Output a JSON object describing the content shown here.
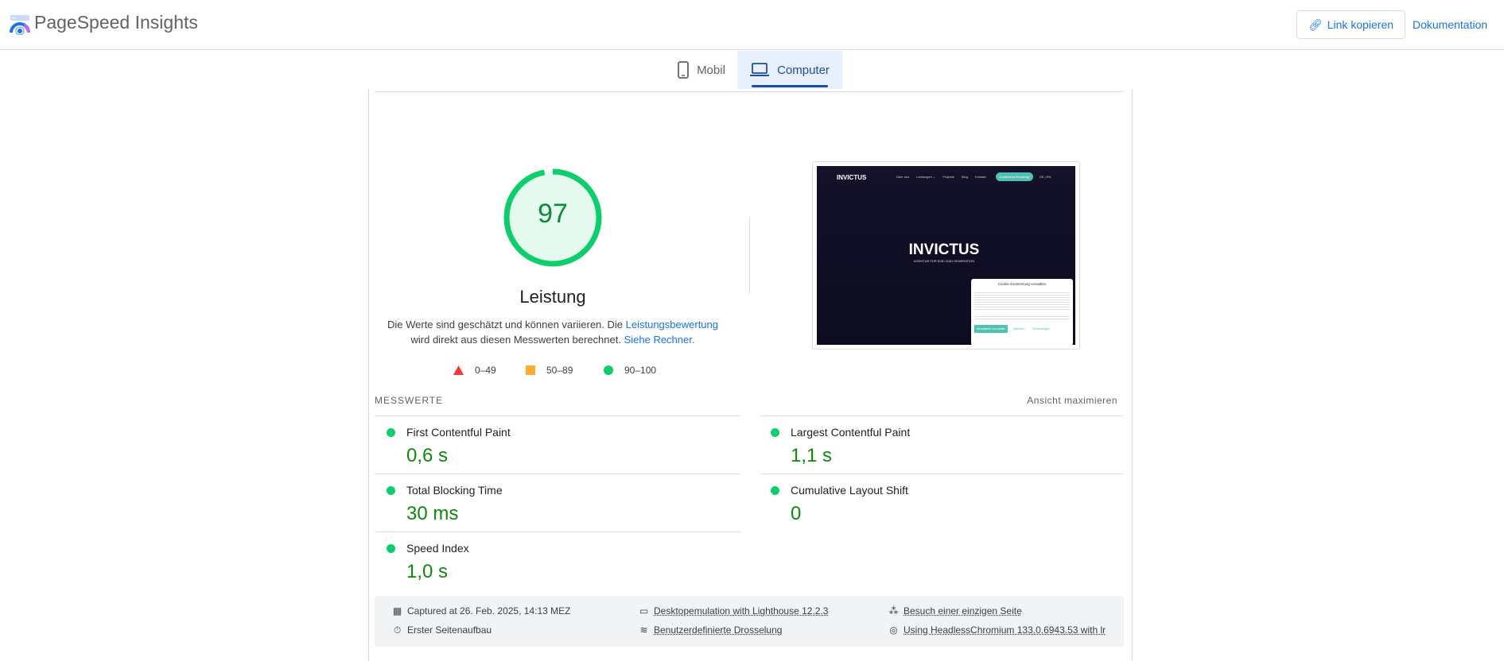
{
  "header": {
    "title": "PageSpeed Insights",
    "copy_link": "Link kopieren",
    "docs": "Dokumentation"
  },
  "tabs": [
    {
      "label": "Mobil"
    },
    {
      "label": "Computer",
      "active": true
    }
  ],
  "score": {
    "value": 97,
    "label": "Leistung",
    "color": "#0cce6b"
  },
  "description": {
    "line1": "Die Werte sind geschätzt und können variieren. Die ",
    "link1": "Leistungsbewertung",
    "line2": "wird direkt aus diesen Messwerten berechnet. ",
    "link2": "Siehe Rechner."
  },
  "legend": [
    {
      "range": "0–49",
      "color": "#ff3333"
    },
    {
      "range": "50–89",
      "color": "#ffaa33"
    },
    {
      "range": "90–100",
      "color": "#0cce6b"
    }
  ],
  "preview": {
    "brand": "INVICTUS",
    "nav": [
      "Über uns",
      "Leistungen ⌄",
      "Projekte",
      "Blog",
      "Kontakt"
    ],
    "cta": "Kostenlose Beratung",
    "lang": "DE | EN",
    "hero": "INVICTUS",
    "subtitle": "AGENTUR FÜR B2B LEAD GENERATION",
    "cookie_title": "Cookie-Zustimmung verwalten",
    "cookie_buttons": [
      "Akzeptieren und weiter",
      "Ablehnen",
      "Einstellungen"
    ]
  },
  "metrics": {
    "heading": "MESSWERTE",
    "expand": "Ansicht maximieren",
    "items": [
      {
        "name": "First Contentful Paint",
        "value": "0,6 s"
      },
      {
        "name": "Largest Contentful Paint",
        "value": "1,1 s"
      },
      {
        "name": "Total Blocking Time",
        "value": "30 ms"
      },
      {
        "name": "Cumulative Layout Shift",
        "value": "0"
      },
      {
        "name": "Speed Index",
        "value": "1,0 s"
      }
    ]
  },
  "footer": {
    "captured": "Captured at 26. Feb. 2025, 14:13 MEZ",
    "emulation": "Desktopemulation with Lighthouse 12.2.3",
    "visit": "Besuch einer einzigen Seite",
    "load": "Erster Seitenaufbau",
    "throttling": "Benutzerdefinierte Drosselung",
    "browser": "Using HeadlessChromium 133.0.6943.53 with lr"
  }
}
